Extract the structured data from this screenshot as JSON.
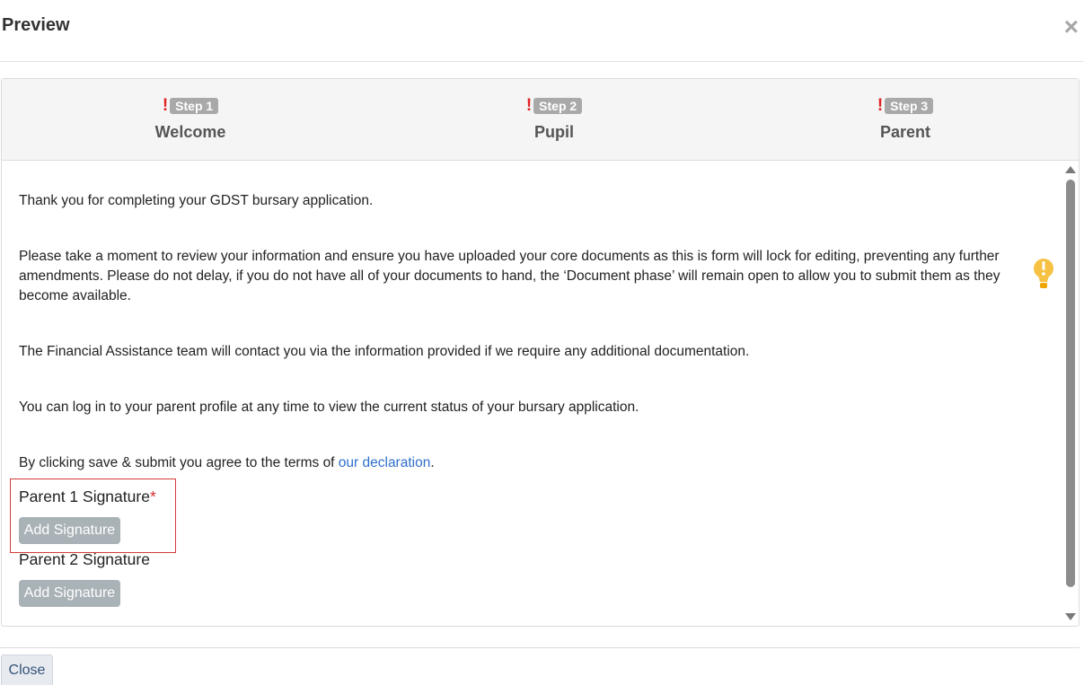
{
  "modal": {
    "title": "Preview",
    "close_icon": "×"
  },
  "steps": [
    {
      "warning": "!",
      "badge": "Step 1",
      "label": "Welcome"
    },
    {
      "warning": "!",
      "badge": "Step 2",
      "label": "Pupil"
    },
    {
      "warning": "!",
      "badge": "Step 3",
      "label": "Parent"
    }
  ],
  "content": {
    "paragraph_1": "Thank you for completing your GDST bursary application.",
    "paragraph_2": "Please take a moment to review your information and ensure you have uploaded your core documents as this is form will lock for editing, preventing any further amendments. Please do not delay, if you do not have all of your documents to hand, the ‘Document phase’ will remain open to allow you to submit them as they become available.",
    "paragraph_3": "The Financial Assistance team will contact you via the information provided if we require any additional documentation.",
    "paragraph_4": "You can log in to your parent profile at any time to view the current status of your bursary application.",
    "declaration_prefix": "By clicking save & submit you agree to the terms of ",
    "declaration_link": "our declaration",
    "declaration_suffix": "."
  },
  "signatures": {
    "parent1_label": "Parent 1 Signature",
    "parent1_required": "*",
    "parent1_button": "Add Signature",
    "parent2_label": "Parent 2 Signature",
    "parent2_button": "Add Signature"
  },
  "footer": {
    "close_label": "Close"
  },
  "icons": {
    "tip": "lightbulb-icon",
    "close": "close-icon",
    "warning": "exclamation-icon"
  },
  "colors": {
    "warning": "#e02424",
    "badge": "#a9a9a9",
    "link": "#2f6fcc",
    "signature_button": "#a9b2b7",
    "highlight_border": "#d23a3a",
    "tip_icon": "#f7c244"
  }
}
